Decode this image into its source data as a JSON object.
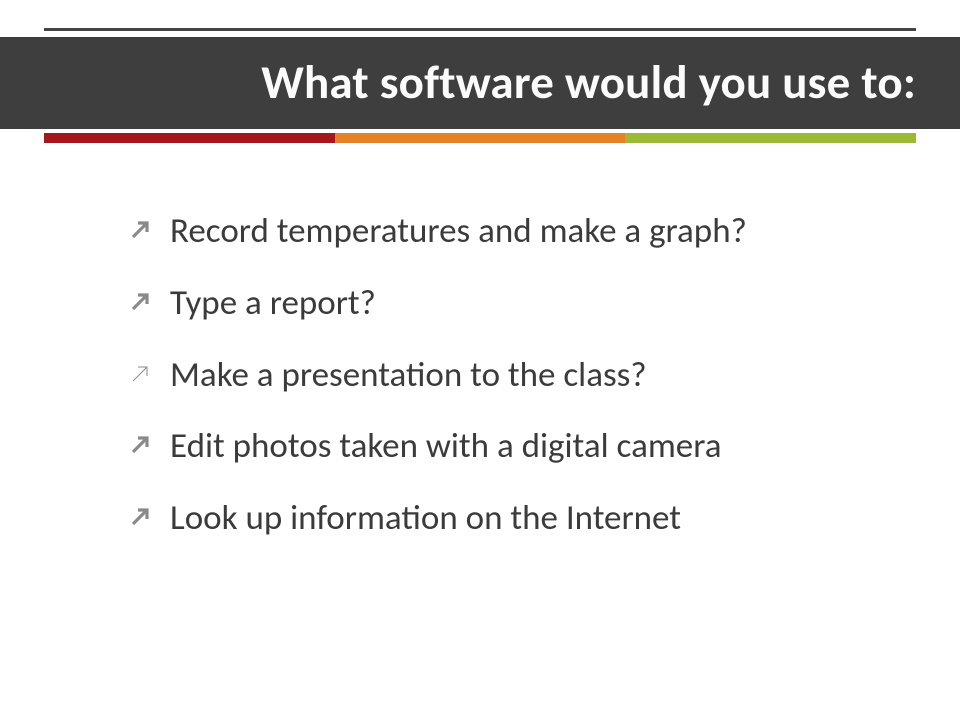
{
  "title": "What software would you use to:",
  "bullets": {
    "b0": "Record temperatures and make a graph?",
    "b1": "Type a report?",
    "b2": "Make a presentation to the class?",
    "b3": "Edit photos taken with a digital camera",
    "b4": "Look up information on the Internet"
  },
  "colors": {
    "title_bg": "#3e3e3e",
    "accent_red": "#a6171c",
    "accent_orange": "#e88125",
    "accent_green": "#9bbb34",
    "bullet_icon": "#8a8a8a",
    "body_text": "#3b3b3b"
  }
}
